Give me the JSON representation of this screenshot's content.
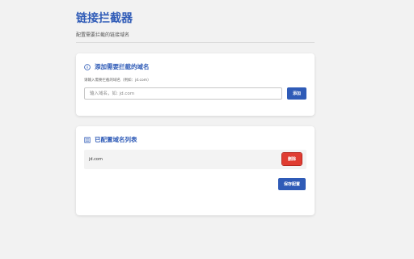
{
  "page": {
    "title": "链接拦截器",
    "subtitle": "配置需要拦截的链接域名"
  },
  "add_section": {
    "heading": "添加需要拦截的域名",
    "hint": "请输入需要拦截的域名（例如：jd.com）",
    "input_value": "",
    "input_placeholder": "输入域名，如: jd.com",
    "add_button": "添加"
  },
  "list_section": {
    "heading": "已配置域名列表",
    "domains": [
      {
        "domain": "jd.com",
        "delete_label": "删除"
      }
    ],
    "save_button": "保存配置"
  },
  "colors": {
    "accent": "#2f5bb7",
    "danger": "#e03c31",
    "background": "#f2f2f2"
  },
  "icons": {
    "add_section": "info-circle-icon",
    "list_section": "list-icon"
  }
}
